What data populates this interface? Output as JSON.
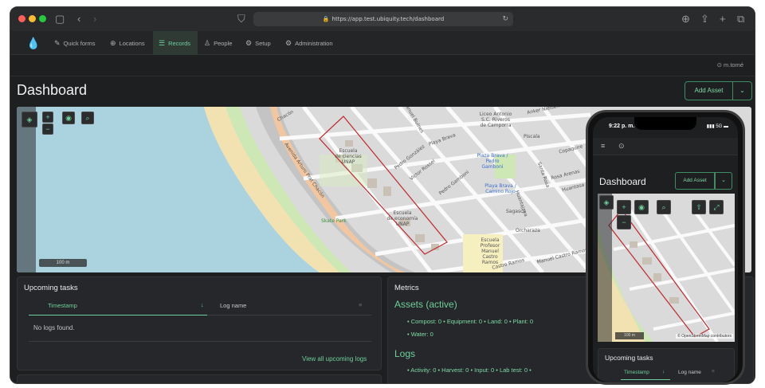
{
  "browser": {
    "url": "https://app.test.ubiquity.tech/dashboard",
    "icons": [
      "sidebar-icon",
      "back-icon",
      "forward-icon",
      "shield-icon",
      "download-icon",
      "share-icon",
      "new-tab-icon",
      "tabs-icon"
    ]
  },
  "nav": {
    "items": [
      {
        "label": "Quick forms",
        "icon": "✎"
      },
      {
        "label": "Locations",
        "icon": "⊕"
      },
      {
        "label": "Records",
        "icon": "☰"
      },
      {
        "label": "People",
        "icon": "♙"
      },
      {
        "label": "Setup",
        "icon": "⚙"
      },
      {
        "label": "Administration",
        "icon": "⚙"
      }
    ],
    "active_index": 2
  },
  "user": {
    "label": "⊙ m.tomé"
  },
  "header": {
    "title": "Dashboard",
    "add_asset_label": "Add Asset",
    "toggle": "⌄"
  },
  "map": {
    "scale_label": "100 m",
    "labels": {
      "escuela_ciencias": "Escuela\nde ciencias\nUNAP",
      "escuela_economia": "Escuela\nde economía\nUNAP",
      "skate": "Skate Park",
      "avenida": "Avenida Arturo Prat Chacón",
      "playa_brava": "Playa Brava",
      "pedro_gonzalez": "Pedro González",
      "victor_rossel": "Victor Rossel",
      "pedro_gamboni": "Pedro Gamboni",
      "playa_brava_2": "Playa Brava",
      "plaza": "Plaza Brava /\nPedro\nGamboni",
      "plaza_2": "Playa Brava /\nCamino Rojo",
      "sagasca": "Sagasca",
      "orcharaza": "Orcharaza",
      "manuel_castro": "Manuel Castro Ramos",
      "castro_ramos": "Castro Ramos",
      "escuela_profesor": "Escuela\nProfesor\nManuel\nCastro\nRamos",
      "anker": "Anker Nielsen",
      "piscala": "Piscala",
      "huantajaya": "Huantajaya",
      "rosa_arenas": "Rosa Arenas",
      "santa_rosa": "Santa Rosa",
      "huaitasa": "Huantasa",
      "copaquire": "Copaquire",
      "colegio": "Liceo Antonio\nS.C. Riveros\nde Camporra",
      "manuel_bulnes": "Manuel Bulnes",
      "chacon": "Chacón"
    }
  },
  "upcoming": {
    "title": "Upcoming tasks",
    "col_timestamp": "Timestamp",
    "col_sort": "↓",
    "col_logname": "Log name",
    "col_filter": "≡",
    "empty": "No logs found.",
    "view_all": "View all upcoming logs"
  },
  "metrics": {
    "title": "Metrics",
    "assets_heading": "Assets (active)",
    "assets_line1": "•  Compost: 0   •  Equipment: 0   •  Land: 0   •  Plant: 0",
    "assets_line2": "•  Water: 0",
    "logs_heading": "Logs",
    "logs_line1": "•  Activity: 0   •  Harvest: 0   •  Input: 0   •  Lab test: 0   •"
  },
  "phone": {
    "time": "9:22 p. m.",
    "status": "▮▮▮ 5G ▬",
    "menu": "≡",
    "user": "⊙",
    "title": "Dashboard",
    "add_asset_label": "Add Asset",
    "toggle": "⌄",
    "scale_label": "100 m",
    "attribution": "© OpenStreetMap contributors",
    "upcoming_title": "Upcoming tasks",
    "col_timestamp": "Timestamp",
    "col_sort": "↓",
    "col_logname": "Log name",
    "col_filter": "≡"
  },
  "colors": {
    "accent": "#6fcf9b",
    "bg": "#1d1f21",
    "panel": "#25272a"
  }
}
